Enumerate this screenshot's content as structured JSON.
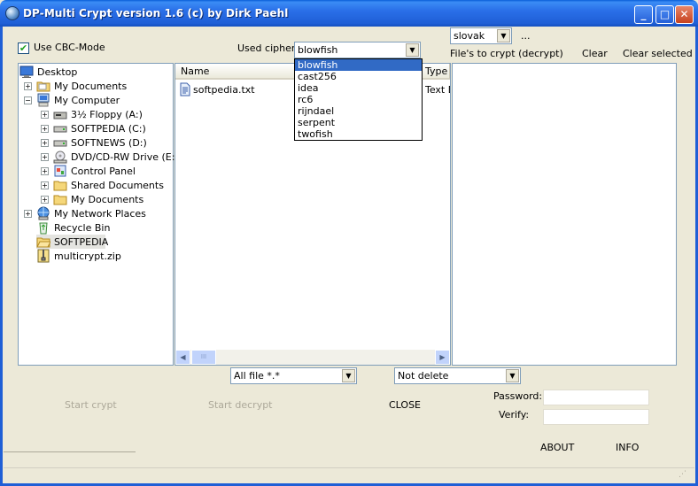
{
  "window": {
    "title": "DP-Multi Crypt version 1.6 (c) by Dirk Paehl",
    "min": "_",
    "max": "□",
    "close": "✕"
  },
  "options": {
    "cbc_label": "Use CBC-Mode",
    "cbc_checked": "✔",
    "cipher_label": "Used cipher",
    "cipher_value": "blowfish",
    "cipher_options": [
      "blowfish",
      "cast256",
      "idea",
      "rc6",
      "rijndael",
      "serpent",
      "twofish"
    ],
    "language_value": "slovak",
    "language_more": "..."
  },
  "crypt_list": {
    "label": "File's to crypt (decrypt)",
    "clear": "Clear",
    "clear_selected": "Clear selected"
  },
  "tree": {
    "items": [
      {
        "label": "Desktop",
        "icon": "desktop-icon"
      },
      {
        "label": "My Documents",
        "icon": "folder-icon"
      },
      {
        "label": "My Computer",
        "icon": "computer-icon"
      },
      {
        "label": "3½ Floppy (A:)",
        "icon": "floppy-icon"
      },
      {
        "label": "SOFTPEDIA (C:)",
        "icon": "drive-icon"
      },
      {
        "label": "SOFTNEWS (D:)",
        "icon": "drive-icon"
      },
      {
        "label": "DVD/CD-RW Drive (E:)",
        "icon": "cd-drive-icon"
      },
      {
        "label": "Control Panel",
        "icon": "control-panel-icon"
      },
      {
        "label": "Shared Documents",
        "icon": "folder-icon"
      },
      {
        "label": "My Documents",
        "icon": "folder-icon"
      },
      {
        "label": "My Network Places",
        "icon": "network-icon"
      },
      {
        "label": "Recycle Bin",
        "icon": "recycle-bin-icon"
      },
      {
        "label": "SOFTPEDIA",
        "icon": "folder-icon"
      },
      {
        "label": "multicrypt.zip",
        "icon": "zip-icon"
      }
    ]
  },
  "files": {
    "col_name": "Name",
    "col_type": "Type",
    "rows": [
      {
        "name": "softpedia.txt",
        "type": "Text D"
      }
    ],
    "scroll_left": "◀",
    "scroll_right": "▶",
    "thumb": "III"
  },
  "filters": {
    "file_filter": "All file *.*",
    "delete_mode": "Not delete"
  },
  "actions": {
    "start_crypt": "Start crypt",
    "start_decrypt": "Start decrypt",
    "close": "CLOSE",
    "password_label": "Password:",
    "verify_label": "Verify:",
    "about": "ABOUT",
    "info": "INFO"
  },
  "icons": {
    "dropdown_arrow": "▼",
    "expand": "+",
    "collapse": "−"
  },
  "colors": {
    "titlebar": "#1f5fd6",
    "selection": "#316ac5",
    "disabled": "#aca899"
  }
}
